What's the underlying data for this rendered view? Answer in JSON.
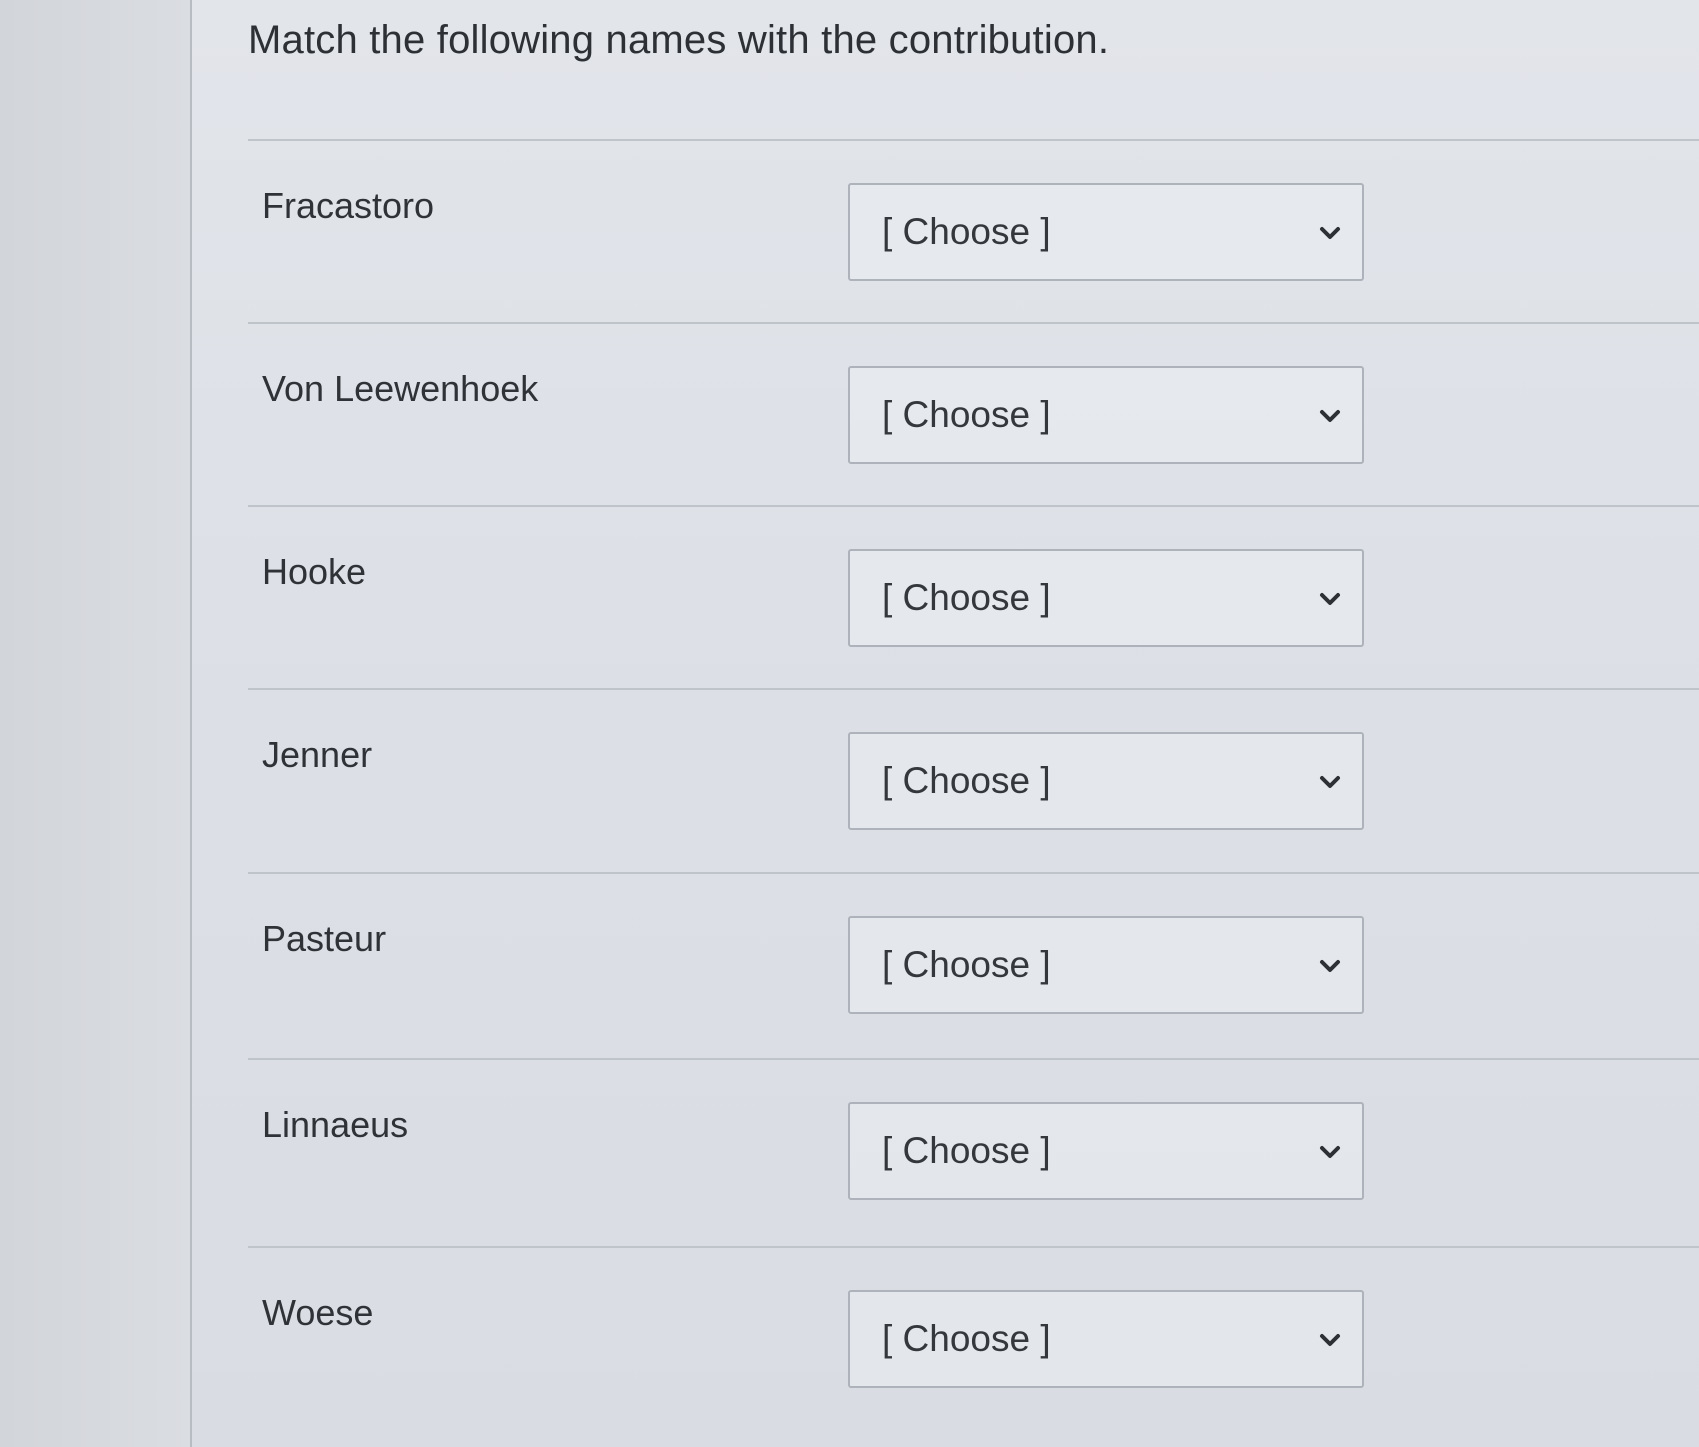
{
  "question": {
    "prompt": "Match the following names with the contribution."
  },
  "matches": [
    {
      "name": "Fracastoro",
      "selected": "[ Choose ]"
    },
    {
      "name": "Von Leewenhoek",
      "selected": "[ Choose ]"
    },
    {
      "name": "Hooke",
      "selected": "[ Choose ]"
    },
    {
      "name": "Jenner",
      "selected": "[ Choose ]"
    },
    {
      "name": "Pasteur",
      "selected": "[ Choose ]"
    },
    {
      "name": "Linnaeus",
      "selected": "[ Choose ]"
    },
    {
      "name": "Woese",
      "selected": "[ Choose ]"
    }
  ],
  "icons": {
    "dropdown": "chevron-down-icon"
  },
  "colors": {
    "text": "#2d3035",
    "border": "#aeb3bb",
    "background": "#dde1e7"
  }
}
